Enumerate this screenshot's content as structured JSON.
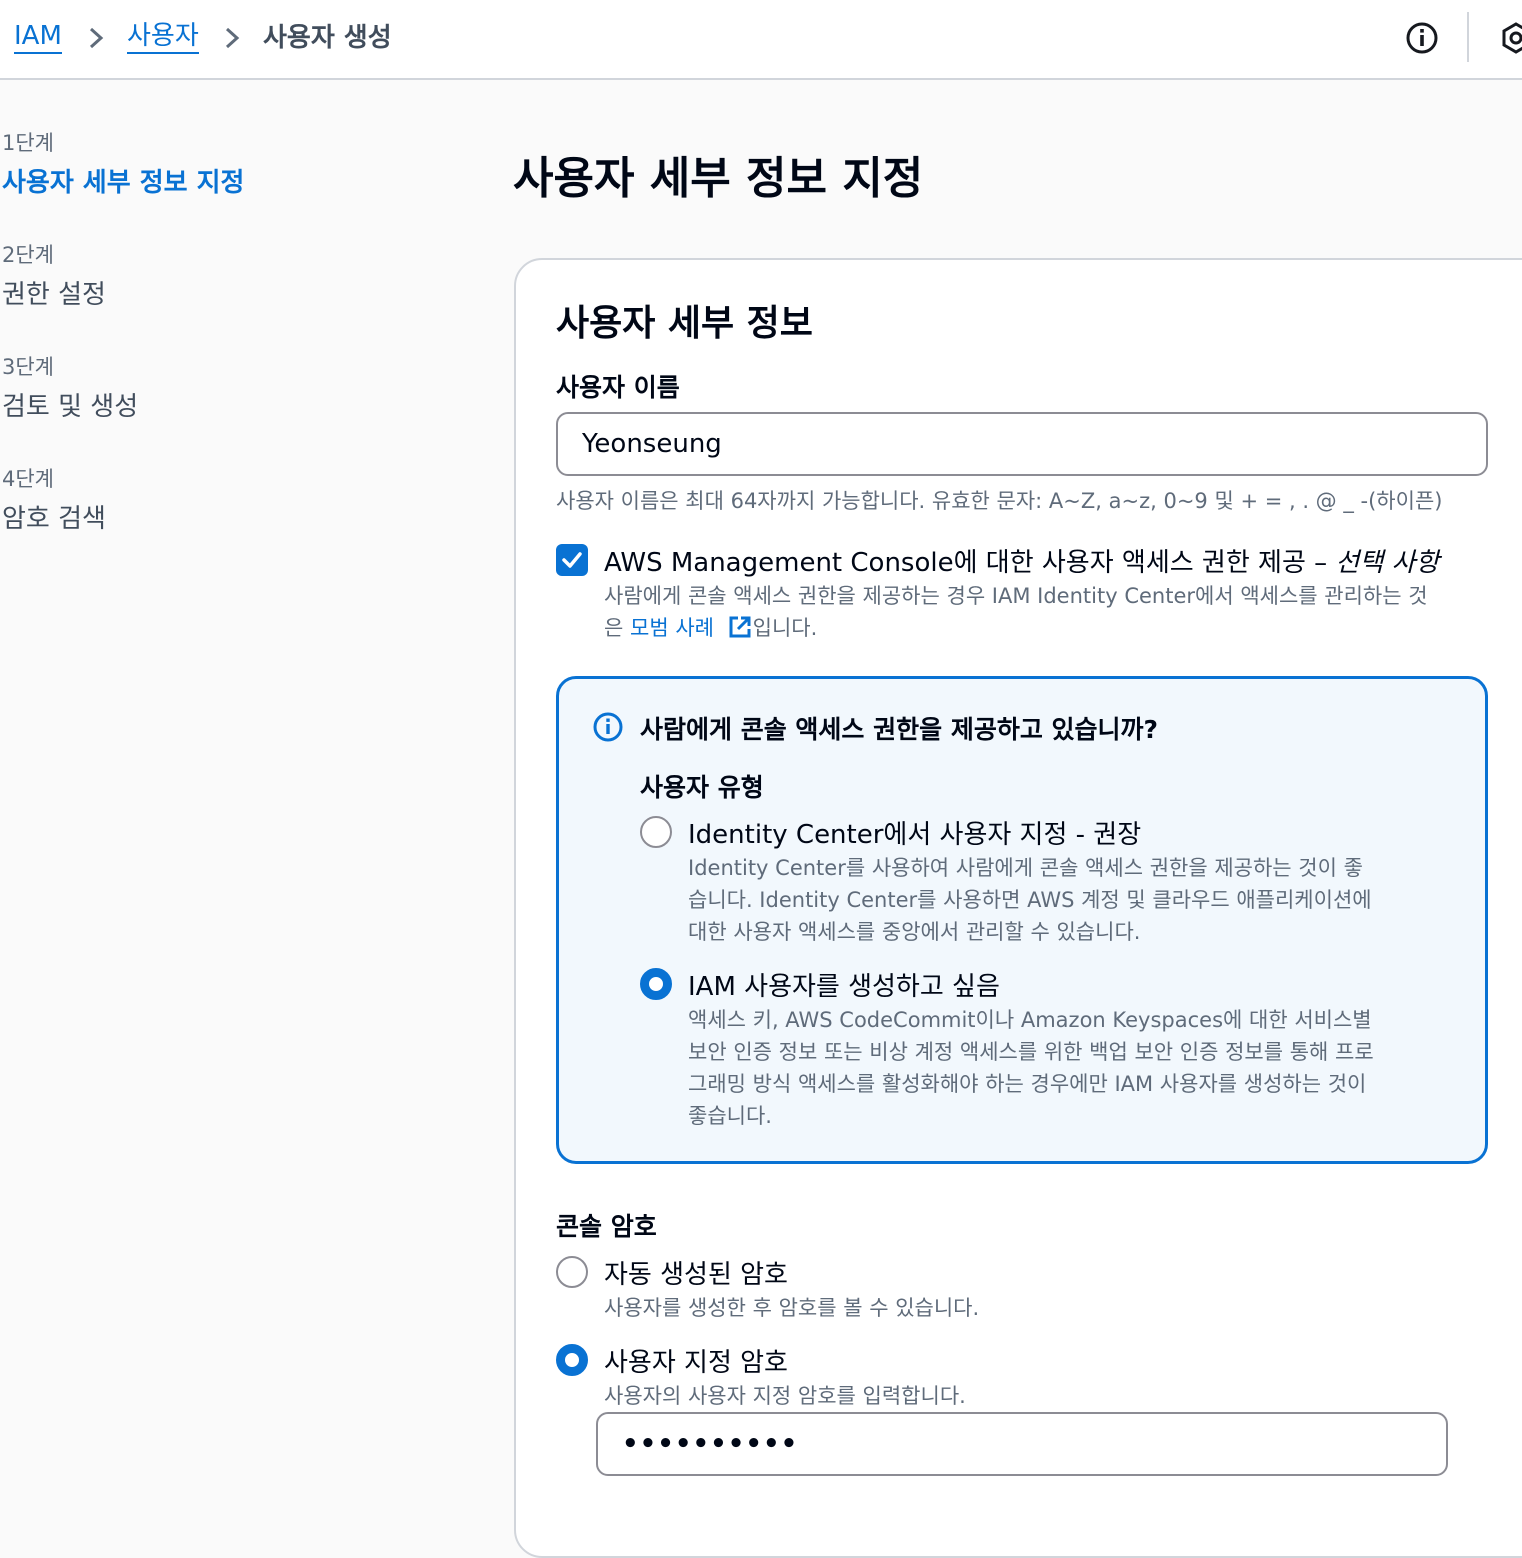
{
  "breadcrumb": {
    "iam": "IAM",
    "users": "사용자",
    "current": "사용자 생성"
  },
  "stepper": [
    {
      "num": "1단계",
      "label": "사용자 세부 정보 지정"
    },
    {
      "num": "2단계",
      "label": "권한 설정"
    },
    {
      "num": "3단계",
      "label": "검토 및 생성"
    },
    {
      "num": "4단계",
      "label": "암호 검색"
    }
  ],
  "page_title": "사용자 세부 정보 지정",
  "card": {
    "title": "사용자 세부 정보",
    "username_label": "사용자 이름",
    "username_value": "Yeonseung",
    "username_hint": "사용자 이름은 최대 64자까지 가능합니다. 유효한 문자: A~Z, a~z, 0~9 및 + = , . @ _ -(하이픈)",
    "console_access": {
      "label_main": "AWS Management Console에 대한 사용자 액세스 권한 제공 – ",
      "label_optional": "선택 사항",
      "checked": true,
      "desc_line1": "사람에게 콘솔 액세스 권한을 제공하는 경우 IAM Identity Center에서 액세스를 관리하는 것",
      "desc_prefix": "은 ",
      "desc_link": "모범 사례",
      "desc_suffix": "입니다."
    },
    "alert": {
      "title": "사람에게 콘솔 액세스 권한을 제공하고 있습니까?",
      "user_type_label": "사용자 유형",
      "options": [
        {
          "label": "Identity Center에서 사용자 지정 - 권장",
          "desc": [
            "Identity Center를 사용하여 사람에게 콘솔 액세스 권한을 제공하는 것이 좋",
            "습니다. Identity Center를 사용하면 AWS 계정 및 클라우드 애플리케이션에",
            "대한 사용자 액세스를 중앙에서 관리할 수 있습니다."
          ],
          "selected": false
        },
        {
          "label": "IAM 사용자를 생성하고 싶음",
          "desc": [
            "액세스 키, AWS CodeCommit이나 Amazon Keyspaces에 대한 서비스별",
            "보안 인증 정보 또는 비상 계정 액세스를 위한 백업 보안 인증 정보를 통해 프로",
            "그래밍 방식 액세스를 활성화해야 하는 경우에만 IAM 사용자를 생성하는 것이",
            "좋습니다."
          ],
          "selected": true
        }
      ]
    },
    "console_password": {
      "label": "콘솔 암호",
      "options": [
        {
          "label": "자동 생성된 암호",
          "desc": "사용자를 생성한 후 암호를 볼 수 있습니다.",
          "selected": false
        },
        {
          "label": "사용자 지정 암호",
          "desc": "사용자의 사용자 지정 암호를 입력합니다.",
          "selected": true
        }
      ],
      "password_value": "••••••••••"
    }
  },
  "colors": {
    "accent": "#0972d3",
    "text_primary": "#000716",
    "text_secondary": "#5f6b7a",
    "alert_bg": "#f2f8fd",
    "border": "#d1d5db"
  },
  "icons": {
    "breadcrumb_separator": "chevron-right-icon",
    "info": "info-icon",
    "external_link": "external-link-icon",
    "checkbox_check": "check-icon"
  }
}
